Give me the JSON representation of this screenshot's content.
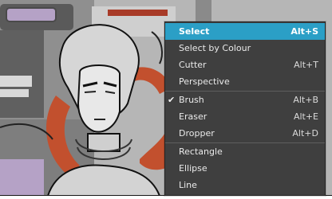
{
  "context_menu": {
    "items": [
      {
        "label": "Select",
        "shortcut": "Alt+S",
        "active": true,
        "checked": false
      },
      {
        "label": "Select by Colour",
        "shortcut": "",
        "active": false,
        "checked": false
      },
      {
        "label": "Cutter",
        "shortcut": "Alt+T",
        "active": false,
        "checked": false
      },
      {
        "label": "Perspective",
        "shortcut": "",
        "active": false,
        "checked": false
      },
      {
        "label": "Brush",
        "shortcut": "Alt+B",
        "active": false,
        "checked": true
      },
      {
        "label": "Eraser",
        "shortcut": "Alt+E",
        "active": false,
        "checked": false
      },
      {
        "label": "Dropper",
        "shortcut": "Alt+D",
        "active": false,
        "checked": false
      },
      {
        "label": "Rectangle",
        "shortcut": "",
        "active": false,
        "checked": false
      },
      {
        "label": "Ellipse",
        "shortcut": "",
        "active": false,
        "checked": false
      },
      {
        "label": "Line",
        "shortcut": "",
        "active": false,
        "checked": false
      }
    ],
    "check_glyph": "✔",
    "highlight_color": "#2b9fc6",
    "background_color": "#3f3f3f"
  },
  "canvas": {
    "description_icon": "drawing-canvas",
    "accent_color": "#c2502e"
  }
}
